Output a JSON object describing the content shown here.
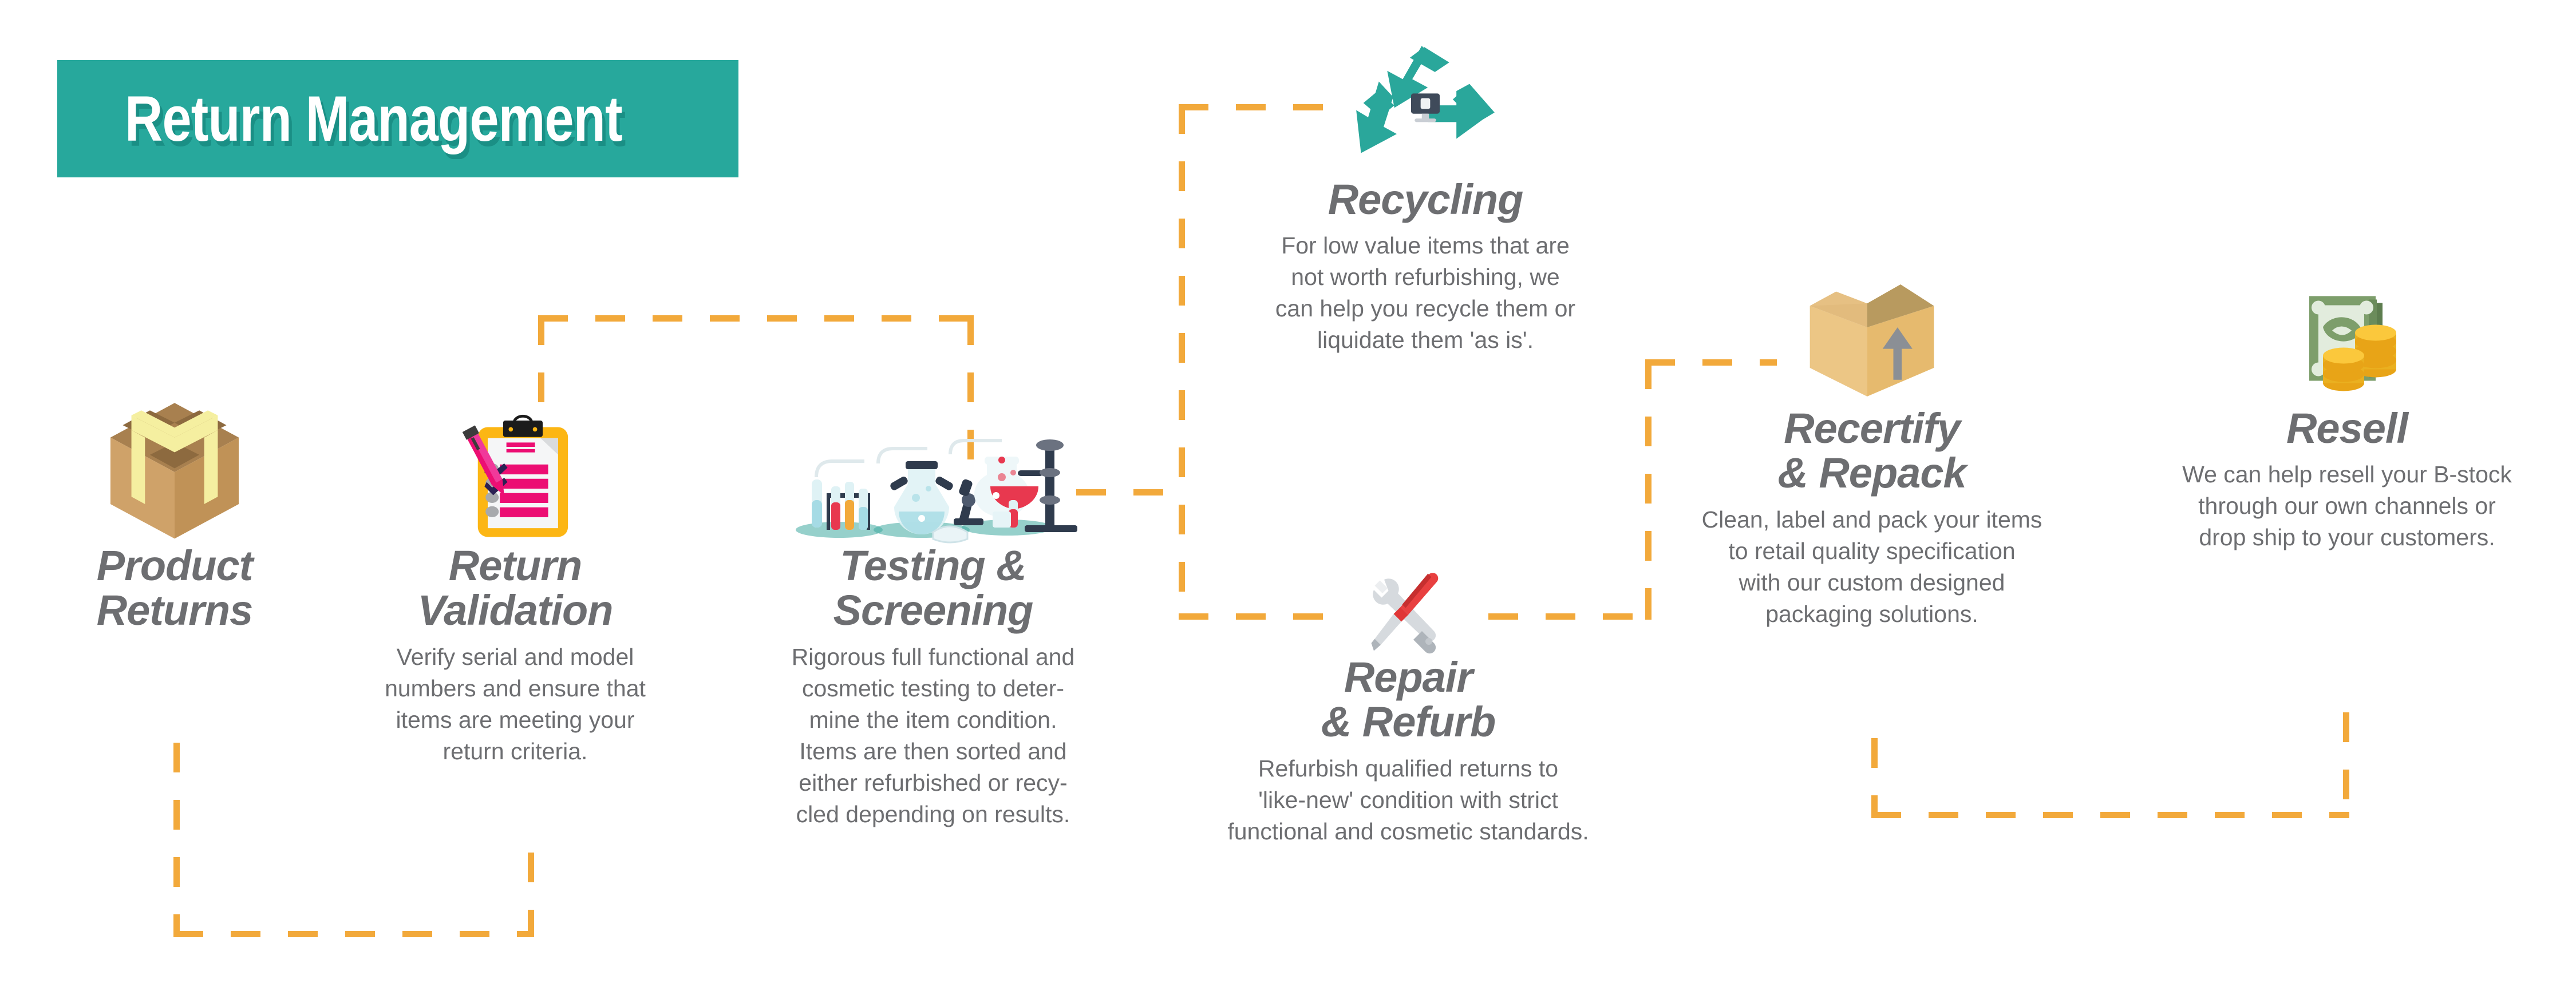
{
  "title": {
    "text": "Return Management",
    "bg_color": "#27a89c",
    "text_color": "#ffffff"
  },
  "theme": {
    "heading_color": "#6d6e71",
    "body_color": "#6d6e71",
    "connector_color": "#f2a93b",
    "accent_teal": "#27a89c"
  },
  "nodes": [
    {
      "id": "product-returns",
      "icon": "cardboard-box-with-ribbon-icon",
      "heading": "Product\nReturns",
      "body": ""
    },
    {
      "id": "return-validation",
      "icon": "clipboard-checklist-icon",
      "heading": "Return\nValidation",
      "body": "Verify serial and model\nnumbers and ensure that\nitems are meeting your\nreturn criteria."
    },
    {
      "id": "testing-screening",
      "icon": "laboratory-equipment-icon",
      "heading": "Testing &\nScreening",
      "body": "Rigorous full functional and\ncosmetic testing to deter-\nmine the item condition.\nItems are then sorted and\neither refurbished or recy-\ncled depending on results."
    },
    {
      "id": "recycling",
      "icon": "recycling-arrows-icon",
      "heading": "Recycling",
      "body": "For low value items that are\nnot worth refurbishing, we\ncan help you recycle them or\nliquidate them 'as is'."
    },
    {
      "id": "repair-refurb",
      "icon": "wrench-screwdriver-icon",
      "heading": "Repair\n& Refurb",
      "body": "Refurbish qualified returns to\n'like-new' condition with strict\nfunctional and cosmetic standards."
    },
    {
      "id": "recertify-repack",
      "icon": "open-shipping-box-icon",
      "heading": "Recertify\n& Repack",
      "body": "Clean, label and pack your items\nto retail quality specification\nwith our custom designed\npackaging solutions."
    },
    {
      "id": "resell",
      "icon": "banknote-coins-icon",
      "heading": "Resell",
      "body": "We can help resell your B-stock\nthrough our own channels or\ndrop ship to your customers."
    }
  ]
}
